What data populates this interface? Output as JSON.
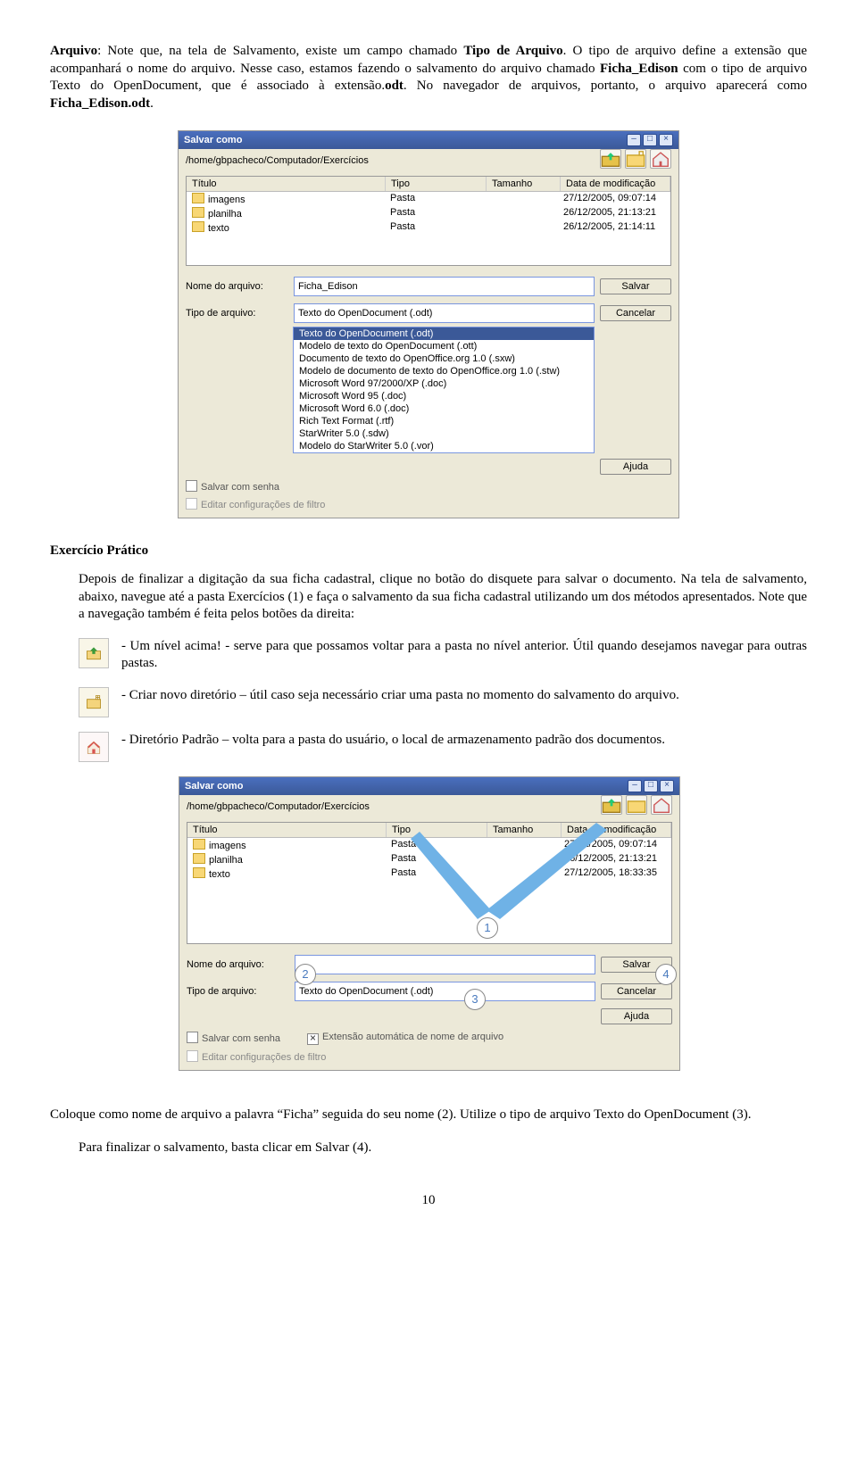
{
  "p1_parts": {
    "a": "Arquivo",
    "b": ": Note que, na tela de Salvamento, existe um campo chamado ",
    "c": "Tipo de Arquivo",
    "d": ". O tipo de arquivo define a extensão que acompanhará o nome do arquivo. Nesse caso, estamos fazendo o salvamento do arquivo chamado ",
    "e": "Ficha_Edison",
    "f": " com o tipo de arquivo Texto do OpenDocument, que é associado à extensão.",
    "g": "odt",
    "h": ". No navegador de arquivos, portanto, o arquivo aparecerá como ",
    "i": "Ficha_Edison.odt",
    "j": "."
  },
  "shot1": {
    "title": "Salvar como",
    "path": "/home/gbpacheco/Computador/Exercícios",
    "cols": {
      "title": "Título",
      "type": "Tipo",
      "size": "Tamanho",
      "date": "Data de modificação"
    },
    "rows": [
      {
        "title": "imagens",
        "type": "Pasta",
        "size": "",
        "date": "27/12/2005, 09:07:14"
      },
      {
        "title": "planilha",
        "type": "Pasta",
        "size": "",
        "date": "26/12/2005, 21:13:21"
      },
      {
        "title": "texto",
        "type": "Pasta",
        "size": "",
        "date": "26/12/2005, 21:14:11"
      }
    ],
    "nameLabel": "Nome do arquivo:",
    "nameValue": "Ficha_Edison",
    "typeLabel": "Tipo de arquivo:",
    "typeValue": "Texto do OpenDocument (.odt)",
    "btnSave": "Salvar",
    "btnCancel": "Cancelar",
    "btnHelp": "Ajuda",
    "dropdown": [
      "Texto do OpenDocument (.odt)",
      "Modelo de texto do OpenDocument (.ott)",
      "Documento de texto do OpenOffice.org 1.0 (.sxw)",
      "Modelo de documento de texto do OpenOffice.org 1.0 (.stw)",
      "Microsoft Word 97/2000/XP (.doc)",
      "Microsoft Word 95 (.doc)",
      "Microsoft Word 6.0 (.doc)",
      "Rich Text Format (.rtf)",
      "StarWriter 5.0 (.sdw)",
      "Modelo do StarWriter 5.0 (.vor)"
    ],
    "chkPwd": "Salvar com senha",
    "chkFilter": "Editar configurações de filtro"
  },
  "sectionTitle": "Exercício Prático",
  "p2": "Depois de finalizar a digitação da sua ficha cadastral, clique no botão do disquete para salvar o documento. Na tela de salvamento, abaixo, navegue até a pasta Exercícios (1) e faça o salvamento da sua ficha cadastral utilizando um dos métodos apresentados. Note que a navegação também é feita pelos botões da direita:",
  "iconUp": "- Um nível acima! - serve para que possamos voltar para a pasta no nível anterior. Útil quando desejamos navegar para outras pastas.",
  "iconNew": "- Criar novo diretório – útil caso seja necessário criar uma pasta no momento do salvamento do arquivo.",
  "iconHome": "- Diretório Padrão – volta para a pasta do usuário, o local de armazenamento padrão dos documentos.",
  "shot2": {
    "title": "Salvar como",
    "path": "/home/gbpacheco/Computador/Exercícios",
    "cols": {
      "title": "Título",
      "type": "Tipo",
      "size": "Tamanho",
      "date": "Data de modificação"
    },
    "rows": [
      {
        "title": "imagens",
        "type": "Pasta",
        "size": "",
        "date": "27/12/2005, 09:07:14"
      },
      {
        "title": "planilha",
        "type": "Pasta",
        "size": "",
        "date": "26/12/2005, 21:13:21"
      },
      {
        "title": "texto",
        "type": "Pasta",
        "size": "",
        "date": "27/12/2005, 18:33:35"
      }
    ],
    "nameLabel": "Nome do arquivo:",
    "nameValue": "",
    "typeLabel": "Tipo de arquivo:",
    "typeValue": "Texto do OpenDocument (.odt)",
    "btnSave": "Salvar",
    "btnCancel": "Cancelar",
    "btnHelp": "Ajuda",
    "chkPwd": "Salvar com senha",
    "chkAuto": "Extensão automática de nome de arquivo",
    "chkFilter": "Editar configurações de filtro"
  },
  "bub": {
    "b1": "1",
    "b2": "2",
    "b3": "3",
    "b4": "4"
  },
  "p3": "Coloque como nome de arquivo a palavra “Ficha” seguida do seu nome (2). Utilize o tipo de arquivo Texto do OpenDocument (3).",
  "p4": "Para finalizar o salvamento, basta clicar em Salvar (4).",
  "pageNum": "10"
}
